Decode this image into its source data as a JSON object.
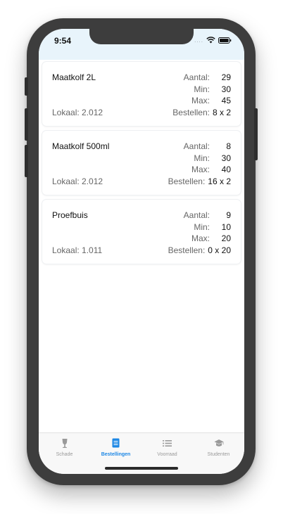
{
  "status": {
    "time": "9:54",
    "signal": "....",
    "wifi_icon": "wifi-icon",
    "battery_icon": "battery-icon"
  },
  "labels": {
    "aantal": "Aantal:",
    "min": "Min:",
    "max": "Max:",
    "bestellen": "Bestellen:"
  },
  "items": [
    {
      "name": "Maatkolf 2L",
      "lokaal": "Lokaal: 2.012",
      "aantal": "29",
      "min": "30",
      "max": "45",
      "bestellen": "8 x 2"
    },
    {
      "name": "Maatkolf 500ml",
      "lokaal": "Lokaal: 2.012",
      "aantal": "8",
      "min": "30",
      "max": "40",
      "bestellen": "16 x 2"
    },
    {
      "name": "Proefbuis",
      "lokaal": "Lokaal: 1.011",
      "aantal": "9",
      "min": "10",
      "max": "20",
      "bestellen": "0 x 20"
    }
  ],
  "tabs": [
    {
      "label": "Schade",
      "icon": "glass-icon",
      "active": false
    },
    {
      "label": "Bestellingen",
      "icon": "order-list-icon",
      "active": true
    },
    {
      "label": "Voorraad",
      "icon": "list-icon",
      "active": false
    },
    {
      "label": "Studenten",
      "icon": "graduation-cap-icon",
      "active": false
    }
  ],
  "colors": {
    "accent": "#1e88e5",
    "inactive": "#9a9a9a",
    "status_bar_bg": "#e8f4fb"
  }
}
